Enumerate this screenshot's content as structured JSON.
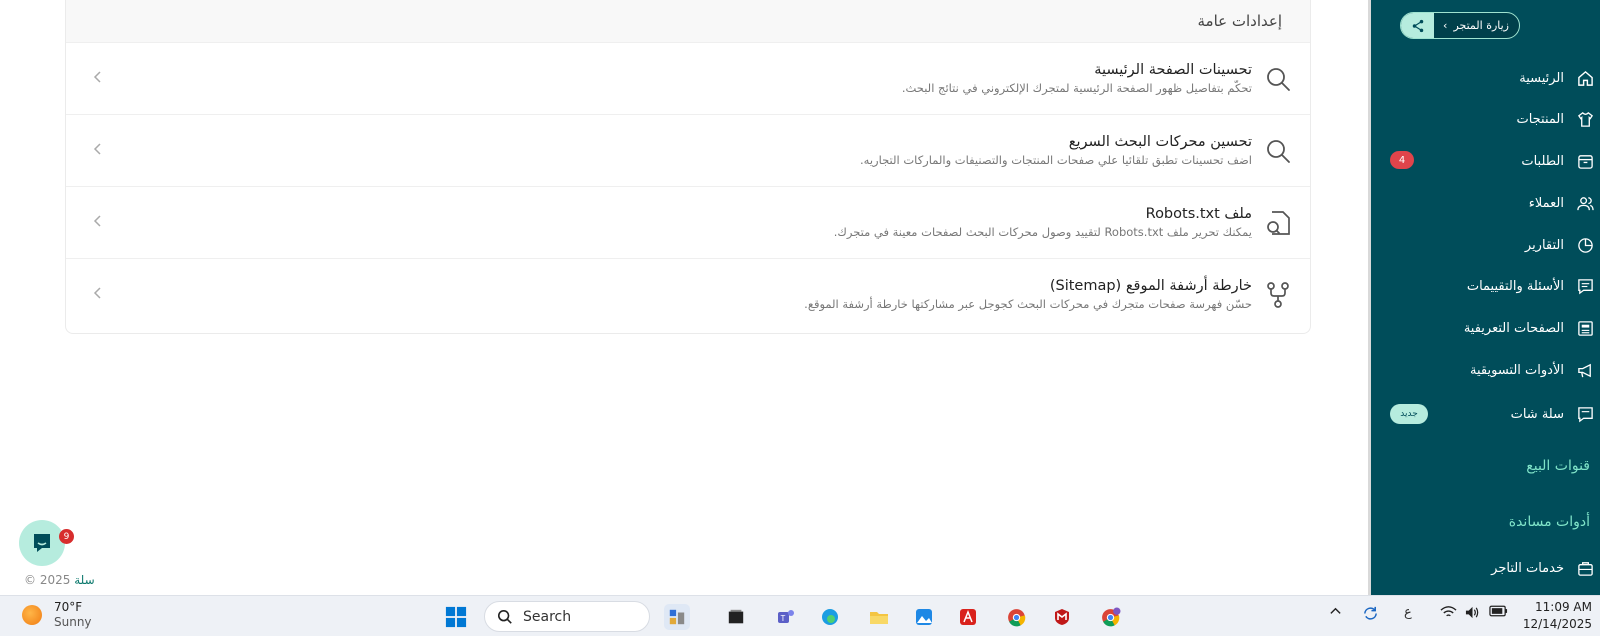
{
  "settings": {
    "header": "إعدادات عامة",
    "rows": [
      {
        "title": "تحسينات الصفحة الرئيسية",
        "desc": "تحكّم بتفاصيل ظهور الصفحة الرئيسية لمتجرك الإلكتروني في نتائج البحث.",
        "icon": "search-icon"
      },
      {
        "title": "تحسين محركات البحث السريع",
        "desc": "اضف تحسينات تطبق تلقائيا علي صفحات المنتجات والتصنيفات والماركات التجاريه.",
        "icon": "search-icon"
      },
      {
        "title": "ملف Robots.txt",
        "desc": "يمكنك تحرير ملف Robots.txt لتقييد وصول محركات البحث لصفحات معينة في متجرك.",
        "icon": "file-search-icon"
      },
      {
        "title": "خارطة أرشفة الموقع (Sitemap)",
        "desc": "حسّن فهرسة صفحات متجرك في محركات البحث كجوجل عبر مشاركتها خارطة أرشفة الموقع.",
        "icon": "sitemap-icon"
      }
    ]
  },
  "chat": {
    "badge": "9"
  },
  "footer": {
    "brand": "سلة",
    "copyright": "© 2025"
  },
  "sidebar": {
    "visit_store": "زيارة المتجر",
    "items": [
      {
        "label": "الرئيسية",
        "icon": "home-icon"
      },
      {
        "label": "المنتجات",
        "icon": "shirt-icon"
      },
      {
        "label": "الطلبات",
        "icon": "orders-icon",
        "badge": "4"
      },
      {
        "label": "العملاء",
        "icon": "users-icon"
      },
      {
        "label": "التقارير",
        "icon": "pie-chart-icon"
      },
      {
        "label": "الأسئلة والتقييمات",
        "icon": "message-icon"
      },
      {
        "label": "الصفحات التعريفية",
        "icon": "newspaper-icon"
      },
      {
        "label": "الأدوات التسويقية",
        "icon": "megaphone-icon"
      },
      {
        "label": "سلة شات",
        "icon": "chat-icon",
        "tag": "جديد"
      }
    ],
    "sections": [
      "قنوات البيع",
      "أدوات مساندة"
    ],
    "bottom_item": {
      "label": "خدمات التاجر",
      "icon": "briefcase-icon"
    }
  },
  "taskbar": {
    "weather_temp": "70°F",
    "weather_cond": "Sunny",
    "search_label": "Search",
    "time": "11:09 AM",
    "date": "12/14/2025",
    "lang": "ع",
    "colors": {
      "windows": "#0078d4",
      "accent": "#004d5a"
    }
  }
}
